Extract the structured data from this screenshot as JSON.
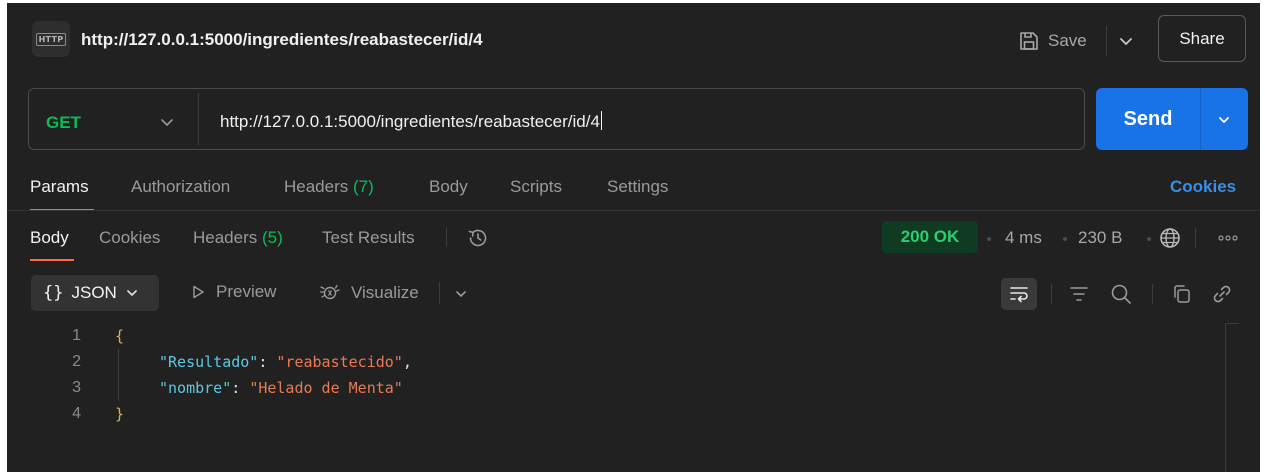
{
  "header": {
    "badge": "HTTP",
    "title": "http://127.0.0.1:5000/ingredientes/reabastecer/id/4",
    "save_label": "Save",
    "share_label": "Share"
  },
  "request": {
    "method": "GET",
    "url": "http://127.0.0.1:5000/ingredientes/reabastecer/id/4",
    "send_label": "Send"
  },
  "request_tabs": {
    "params": "Params",
    "authorization": "Authorization",
    "headers": "Headers",
    "headers_count": "(7)",
    "body": "Body",
    "scripts": "Scripts",
    "settings": "Settings",
    "cookies": "Cookies"
  },
  "response_tabs": {
    "body": "Body",
    "cookies": "Cookies",
    "headers": "Headers",
    "headers_count": "(5)",
    "test_results": "Test Results"
  },
  "response_meta": {
    "status": "200 OK",
    "time": "4 ms",
    "size": "230 B"
  },
  "format_bar": {
    "braces": "{}",
    "format": "JSON",
    "preview": "Preview",
    "visualize": "Visualize"
  },
  "code": {
    "line_numbers": [
      "1",
      "2",
      "3",
      "4"
    ],
    "open_brace": "{",
    "close_brace": "}",
    "key1": "\"Resultado\"",
    "val1": "\"reabastecido\"",
    "key2": "\"nombre\"",
    "val2": "\"Helado de Menta\"",
    "colon": ": ",
    "comma": ","
  },
  "colors": {
    "background": "#212121",
    "accent_orange": "#ff6c37",
    "send_blue": "#1873e6",
    "method_green": "#0cbb52",
    "status_green": "#2ecc71"
  }
}
